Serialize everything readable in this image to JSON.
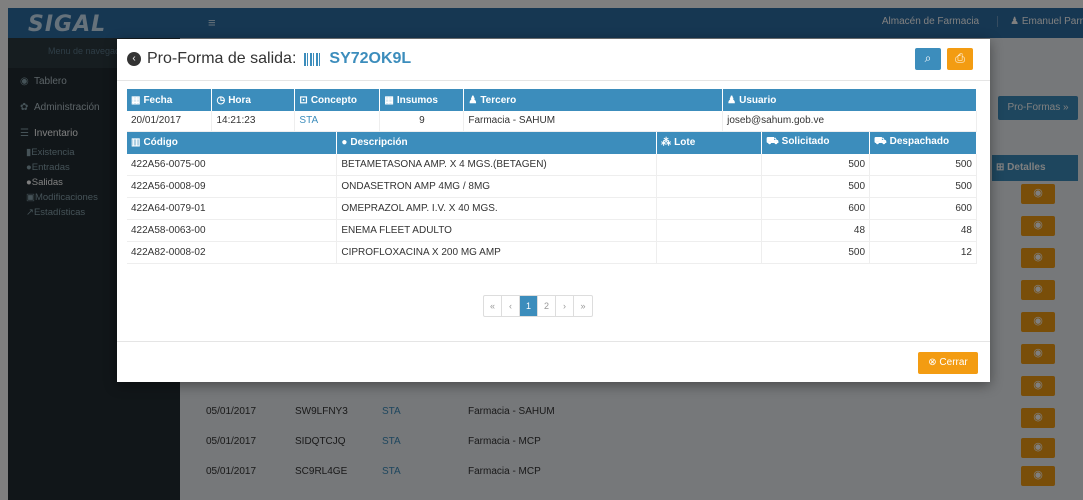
{
  "app": {
    "logo": "SIGAL",
    "menu_icon": "menu-icon",
    "warehouse": "Almacén de Farmacia",
    "user": "Emanuel Parr"
  },
  "sidebar": {
    "search_placeholder": "Menu de navegación",
    "items": [
      {
        "icon": "dashboard-icon",
        "label": "Tablero"
      },
      {
        "icon": "gear-icon",
        "label": "Administración"
      },
      {
        "icon": "list-icon",
        "label": "Inventario"
      }
    ],
    "subitems": [
      {
        "icon": "bar-chart-icon",
        "label": "Existencia"
      },
      {
        "icon": "entry-icon",
        "label": "Entradas"
      },
      {
        "icon": "exit-icon",
        "label": "Salidas"
      },
      {
        "icon": "edit-icon",
        "label": "Modificaciones"
      },
      {
        "icon": "line-chart-icon",
        "label": "Estadísticas"
      }
    ]
  },
  "background": {
    "proformas_button": "Pro-Formas »",
    "details_header": "Detalles",
    "rows": [
      {
        "fecha": "05/01/2017",
        "codigo": "SW9LFNY3",
        "concepto": "STA",
        "tercero": "Farmacia - SAHUM"
      },
      {
        "fecha": "05/01/2017",
        "codigo": "SIDQTCJQ",
        "concepto": "STA",
        "tercero": "Farmacia - MCP"
      },
      {
        "fecha": "05/01/2017",
        "codigo": "SC9RL4GE",
        "concepto": "STA",
        "tercero": "Farmacia - MCP"
      }
    ]
  },
  "modal": {
    "title": "Pro-Forma de salida:",
    "code": "SY72OK9L",
    "info_headers": [
      "Fecha",
      "Hora",
      "Concepto",
      "Insumos",
      "Tercero",
      "Usuario"
    ],
    "info_row": {
      "fecha": "20/01/2017",
      "hora": "14:21:23",
      "concepto": "STA",
      "insumos": "9",
      "tercero": "Farmacia - SAHUM",
      "usuario": "joseb@sahum.gob.ve"
    },
    "items_headers": [
      "Código",
      "Descripción",
      "Lote",
      "Solicitado",
      "Despachado"
    ],
    "items": [
      {
        "codigo": "422A56-0075-00",
        "descripcion": "BETAMETASONA AMP. X 4 MGS.(BETAGEN)",
        "lote": "",
        "solicitado": "500",
        "despachado": "500"
      },
      {
        "codigo": "422A56-0008-09",
        "descripcion": "ONDASETRON AMP 4MG / 8MG",
        "lote": "",
        "solicitado": "500",
        "despachado": "500"
      },
      {
        "codigo": "422A64-0079-01",
        "descripcion": "OMEPRAZOL AMP. I.V. X 40 MGS.",
        "lote": "",
        "solicitado": "600",
        "despachado": "600"
      },
      {
        "codigo": "422A58-0063-00",
        "descripcion": "ENEMA FLEET ADULTO",
        "lote": "",
        "solicitado": "48",
        "despachado": "48"
      },
      {
        "codigo": "422A82-0008-02",
        "descripcion": "CIPROFLOXACINA X 200 MG AMP",
        "lote": "",
        "solicitado": "500",
        "despachado": "12"
      }
    ],
    "pagination": {
      "first": "«",
      "prev": "‹",
      "pages": [
        "1",
        "2"
      ],
      "active": "1",
      "next": "›",
      "last": "»"
    },
    "close_label": "Cerrar"
  }
}
